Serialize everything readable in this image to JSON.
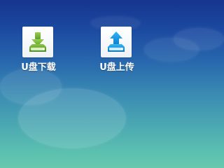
{
  "apps": {
    "download": {
      "label": "U盘下载",
      "icon": "usb-download-icon",
      "color": "#73b83a"
    },
    "upload": {
      "label": "U盘上传",
      "icon": "usb-upload-icon",
      "color": "#1f9be6"
    }
  },
  "colors": {
    "background_top": "#16358f",
    "background_bottom": "#67c9ad",
    "label_text": "#ffffff"
  }
}
